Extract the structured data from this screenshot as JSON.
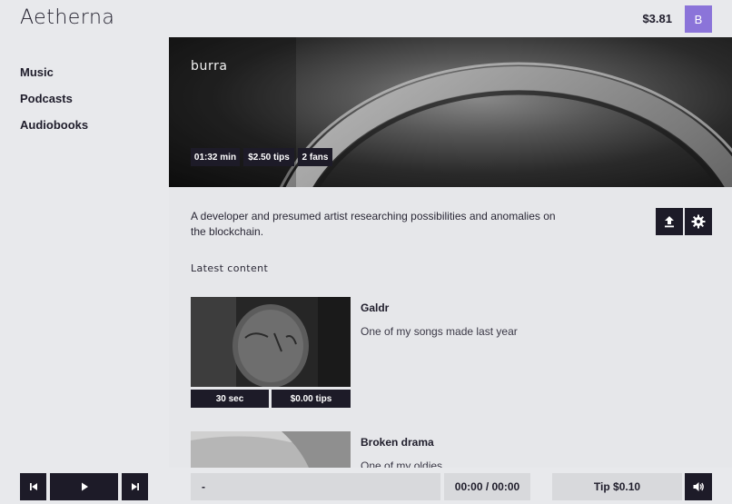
{
  "header": {
    "logo": "Aetherna",
    "balance": "$3.81",
    "avatar_letter": "B"
  },
  "sidebar": {
    "items": [
      {
        "label": "Music"
      },
      {
        "label": "Podcasts"
      },
      {
        "label": "Audiobooks"
      }
    ]
  },
  "artist": {
    "name": "burra",
    "stats": {
      "duration": "01:32 min",
      "tips": "$2.50 tips",
      "fans": "2 fans"
    },
    "bio": "A developer and presumed artist researching possibilities and anomalies on the blockchain."
  },
  "content": {
    "section_title": "Latest content",
    "items": [
      {
        "title": "Galdr",
        "description": "One of my songs made last year",
        "duration": "30 sec",
        "tips": "$0.00 tips"
      },
      {
        "title": "Broken drama",
        "description": "One of my oldies"
      }
    ]
  },
  "player": {
    "track": "-",
    "time": "00:00 / 00:00",
    "tip_label": "Tip $0.10"
  },
  "icons": [
    "upload-icon",
    "settings-gear-icon",
    "skip-previous-icon",
    "play-icon",
    "skip-next-icon",
    "volume-icon"
  ]
}
